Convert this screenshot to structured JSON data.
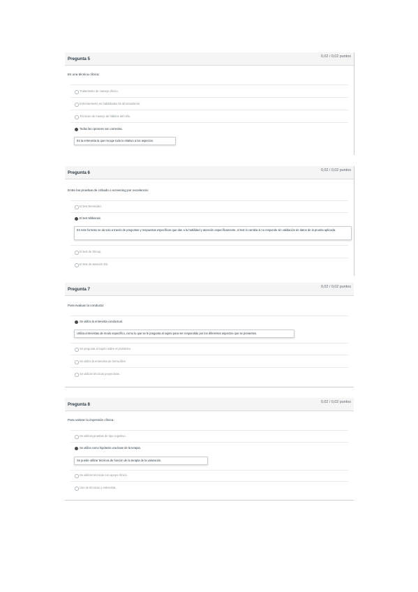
{
  "questions": [
    {
      "title": "Pregunta 5",
      "points": "0,02 / 0,02 puntos",
      "text": "Es una técnica clínica:",
      "options": [
        "Tratamiento de manejo clínico.",
        "Entrenamiento en habilidades de afrontamiento.",
        "Técnicas de manejo de hábitos del niño.",
        "Todas las opciones son correctas."
      ],
      "selected_index": 3,
      "feedback": "Es la entrevista la que recoge todo lo relativo a los aspectos."
    },
    {
      "title": "Pregunta 6",
      "points": "0,02 / 0,02 puntos",
      "text": "Entre las pruebas de cribado o screening por excelencia:",
      "options": [
        "El test Bermúdez.",
        "El test Millennial.",
        "El test de Stroop.",
        "El test de atención D2."
      ],
      "selected_index": 1,
      "feedback": "En este formato se da solo a través de preguntas y respuestas específicas que dan a la habilidad y atención específicamente, el test lo cambia si no responde sin validación de datos de la prueba aplicada."
    },
    {
      "title": "Pregunta 7",
      "points": "0,02 / 0,02 puntos",
      "text": "Para evaluar la conducta:",
      "options": [
        "Se utiliza la entrevista conductual.",
        "Se pregunta al sujeto sobre el problema.",
        "Se utiliza la entrevista de forma libre.",
        "Se utilizan técnicas proyectivas."
      ],
      "selected_index": 0,
      "feedback": "Utiliza entrevistas de modo específico, como lo que se le pregunta al sujeto para ser respondido por los diferentes aspectos que se presenten."
    },
    {
      "title": "Pregunta 8",
      "points": "0,02 / 0,02 puntos",
      "text": "Para valorar la impresión clínica:",
      "options": [
        "Se utilizan pruebas de tipo cognitivo.",
        "Se utiliza como hipótesis una base de la terapia.",
        "Se utilizan técnicas con apoyo clínico.",
        "Uso de técnicas y entrevista."
      ],
      "selected_index": 1,
      "feedback": "Se puede utilizar técnicas de función de la terapia de la valoración."
    }
  ]
}
